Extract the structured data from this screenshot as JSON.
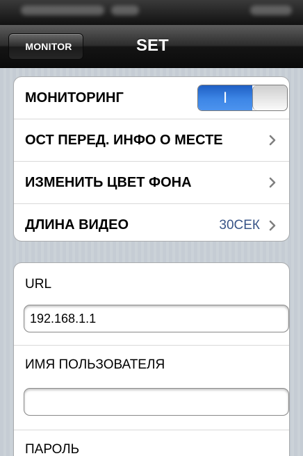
{
  "nav": {
    "back_label": "MONITOR",
    "title": "SET"
  },
  "settings": {
    "monitoring": {
      "label": "МОНИТОРИНГ",
      "toggle_text": "I",
      "enabled": true
    },
    "items": [
      {
        "label": "ОСТ ПЕРЕД. ИНФО О МЕСТЕ",
        "value": ""
      },
      {
        "label": "ИЗМЕНИТЬ ЦВЕТ ФОНА",
        "value": ""
      },
      {
        "label": "ДЛИНА ВИДЕО",
        "value": "30СЕК"
      }
    ]
  },
  "connection": {
    "url_label": "URL",
    "url_value": "192.168.1.1",
    "username_label": "ИМЯ ПОЛЬЗОВАТЕЛЯ",
    "username_value": "",
    "password_label": "ПАРОЛЬ"
  },
  "colors": {
    "toggle_on": "#3d86e6",
    "value_text": "#385487",
    "navbar": "#1a1a1a"
  },
  "icons": {
    "back": "back-arrow-icon",
    "chevron": "chevron-right-icon"
  }
}
